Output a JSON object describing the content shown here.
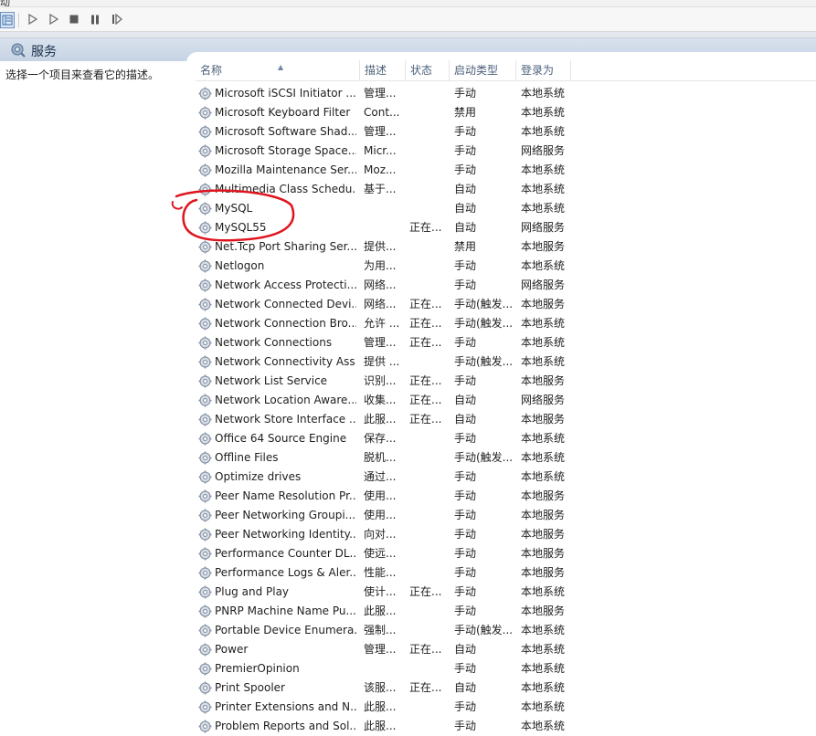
{
  "window": {
    "menu_cut_text": "动"
  },
  "toolbar": {
    "icons": [
      "view-pane-icon",
      "play-icon",
      "play-alt-icon",
      "stop-icon",
      "pause-icon",
      "restart-icon"
    ]
  },
  "header_band": {
    "title": "服务"
  },
  "left_pane": {
    "description": "选择一个项目来查看它的描述。"
  },
  "columns": {
    "name": "名称",
    "desc": "描述",
    "status": "状态",
    "startup": "启动类型",
    "logon": "登录为"
  },
  "services": [
    {
      "name": "Microsoft iSCSI Initiator ...",
      "desc": "管理...",
      "status": "",
      "startup": "手动",
      "logon": "本地系统"
    },
    {
      "name": "Microsoft Keyboard Filter",
      "desc": "Cont...",
      "status": "",
      "startup": "禁用",
      "logon": "本地系统"
    },
    {
      "name": "Microsoft Software Shad...",
      "desc": "管理...",
      "status": "",
      "startup": "手动",
      "logon": "本地系统"
    },
    {
      "name": "Microsoft Storage Space...",
      "desc": "Micr...",
      "status": "",
      "startup": "手动",
      "logon": "网络服务"
    },
    {
      "name": "Mozilla Maintenance Ser...",
      "desc": "Moz...",
      "status": "",
      "startup": "手动",
      "logon": "本地系统"
    },
    {
      "name": "Multimedia Class Schedu...",
      "desc": "基于...",
      "status": "",
      "startup": "自动",
      "logon": "本地系统"
    },
    {
      "name": "MySQL",
      "desc": "",
      "status": "",
      "startup": "自动",
      "logon": "本地系统"
    },
    {
      "name": "MySQL55",
      "desc": "",
      "status": "正在...",
      "startup": "自动",
      "logon": "网络服务"
    },
    {
      "name": "Net.Tcp Port Sharing Ser...",
      "desc": "提供...",
      "status": "",
      "startup": "禁用",
      "logon": "本地服务"
    },
    {
      "name": "Netlogon",
      "desc": "为用...",
      "status": "",
      "startup": "手动",
      "logon": "本地系统"
    },
    {
      "name": "Network Access Protecti...",
      "desc": "网络...",
      "status": "",
      "startup": "手动",
      "logon": "网络服务"
    },
    {
      "name": "Network Connected Devi...",
      "desc": "网络...",
      "status": "正在...",
      "startup": "手动(触发...",
      "logon": "本地服务"
    },
    {
      "name": "Network Connection Bro...",
      "desc": "允许 ...",
      "status": "正在...",
      "startup": "手动(触发...",
      "logon": "本地系统"
    },
    {
      "name": "Network Connections",
      "desc": "管理...",
      "status": "正在...",
      "startup": "手动",
      "logon": "本地系统"
    },
    {
      "name": "Network Connectivity Ass...",
      "desc": "提供 ...",
      "status": "",
      "startup": "手动(触发...",
      "logon": "本地系统"
    },
    {
      "name": "Network List Service",
      "desc": "识别...",
      "status": "正在...",
      "startup": "手动",
      "logon": "本地服务"
    },
    {
      "name": "Network Location Aware...",
      "desc": "收集...",
      "status": "正在...",
      "startup": "自动",
      "logon": "网络服务"
    },
    {
      "name": "Network Store Interface ...",
      "desc": "此服...",
      "status": "正在...",
      "startup": "自动",
      "logon": "本地服务"
    },
    {
      "name": "Office 64 Source Engine",
      "desc": "保存...",
      "status": "",
      "startup": "手动",
      "logon": "本地系统"
    },
    {
      "name": "Offline Files",
      "desc": "脱机...",
      "status": "",
      "startup": "手动(触发...",
      "logon": "本地系统"
    },
    {
      "name": "Optimize drives",
      "desc": "通过...",
      "status": "",
      "startup": "手动",
      "logon": "本地系统"
    },
    {
      "name": "Peer Name Resolution Pr...",
      "desc": "使用...",
      "status": "",
      "startup": "手动",
      "logon": "本地服务"
    },
    {
      "name": "Peer Networking Groupi...",
      "desc": "使用...",
      "status": "",
      "startup": "手动",
      "logon": "本地服务"
    },
    {
      "name": "Peer Networking Identity...",
      "desc": "向对...",
      "status": "",
      "startup": "手动",
      "logon": "本地服务"
    },
    {
      "name": "Performance Counter DL...",
      "desc": "使远...",
      "status": "",
      "startup": "手动",
      "logon": "本地服务"
    },
    {
      "name": "Performance Logs & Aler...",
      "desc": "性能...",
      "status": "",
      "startup": "手动",
      "logon": "本地服务"
    },
    {
      "name": "Plug and Play",
      "desc": "使计...",
      "status": "正在...",
      "startup": "手动",
      "logon": "本地系统"
    },
    {
      "name": "PNRP Machine Name Pu...",
      "desc": "此服...",
      "status": "",
      "startup": "手动",
      "logon": "本地服务"
    },
    {
      "name": "Portable Device Enumera...",
      "desc": "强制...",
      "status": "",
      "startup": "手动(触发...",
      "logon": "本地系统"
    },
    {
      "name": "Power",
      "desc": "管理...",
      "status": "正在...",
      "startup": "自动",
      "logon": "本地系统"
    },
    {
      "name": "PremierOpinion",
      "desc": "",
      "status": "",
      "startup": "手动",
      "logon": "本地系统"
    },
    {
      "name": "Print Spooler",
      "desc": "该服...",
      "status": "正在...",
      "startup": "自动",
      "logon": "本地系统"
    },
    {
      "name": "Printer Extensions and N...",
      "desc": "此服...",
      "status": "",
      "startup": "手动",
      "logon": "本地系统"
    },
    {
      "name": "Problem Reports and Sol...",
      "desc": "此服...",
      "status": "",
      "startup": "手动",
      "logon": "本地系统"
    }
  ],
  "colors": {
    "band": "#c6d3e3",
    "annotation": "#e0141e",
    "header_text": "#4c607a"
  }
}
